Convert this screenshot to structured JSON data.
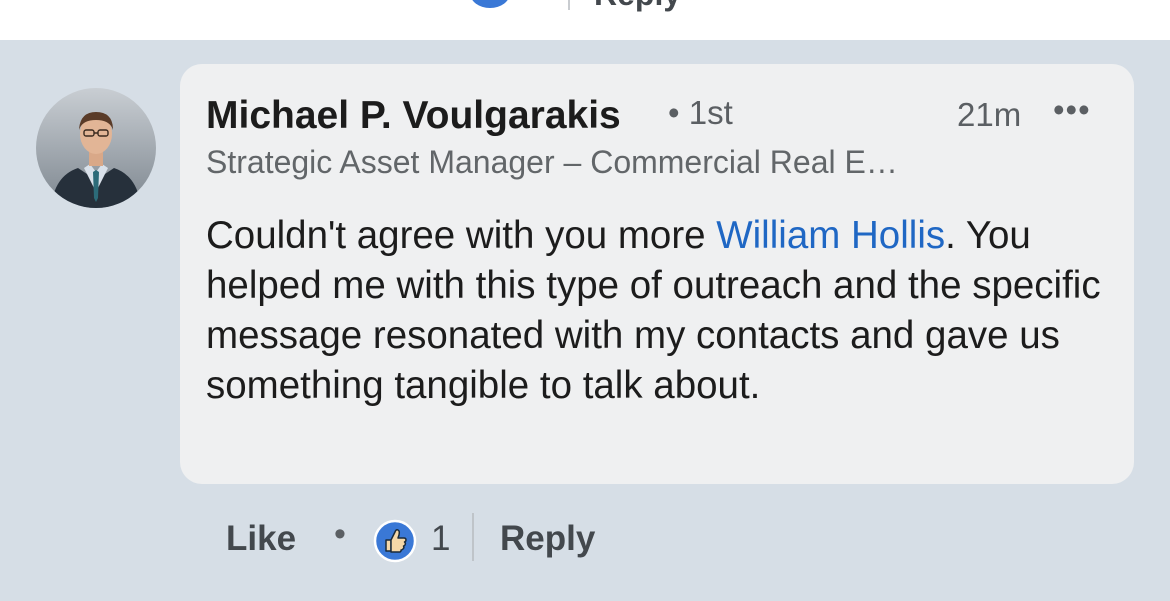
{
  "top_action_bar": {
    "reply_label": "Reply"
  },
  "comment": {
    "author": "Michael P. Voulgarakis",
    "degree": "• 1st",
    "timestamp": "21m",
    "more_label": "•••",
    "headline": "Strategic Asset Manager – Commercial Real E…",
    "text_before_mention": "Couldn't agree with you more ",
    "mention": "William Hollis",
    "text_after_mention": ". You helped me with this type of outreach and the specific message resonated with my contacts and gave us something tangible to talk about."
  },
  "actions": {
    "like_label": "Like",
    "separator": "•",
    "reaction_count": "1",
    "reply_label": "Reply"
  },
  "colors": {
    "background": "#d6dee6",
    "bubble": "#eff0f1",
    "mention": "#1f67c4",
    "like_icon": "#3a78d6"
  }
}
